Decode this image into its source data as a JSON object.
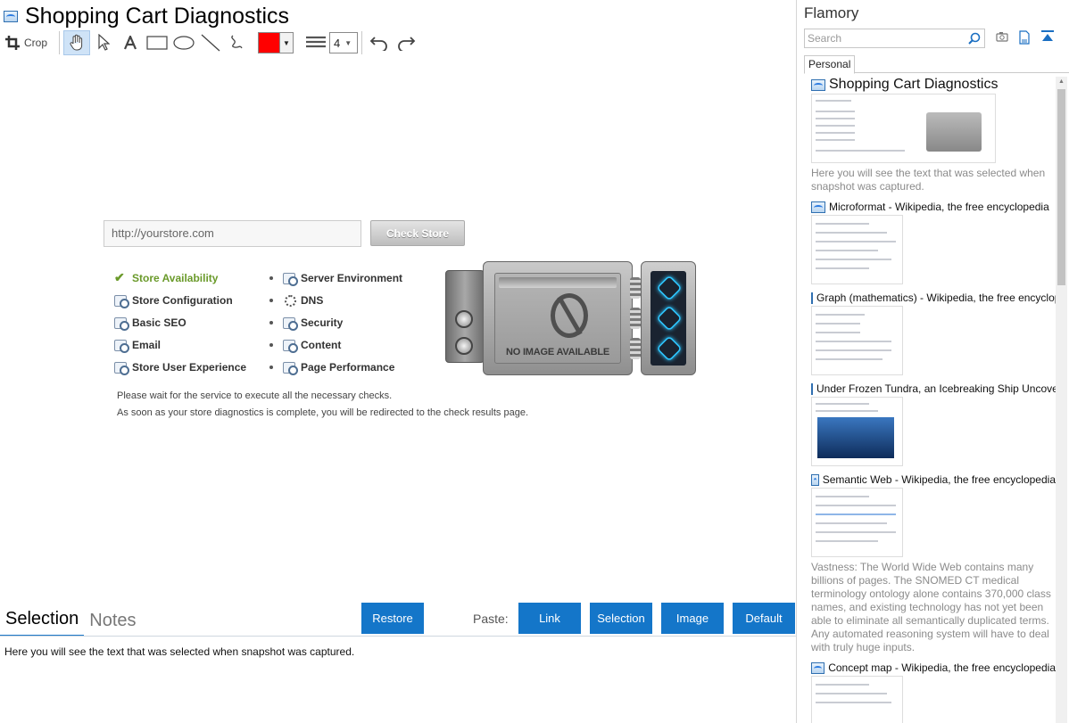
{
  "document": {
    "title": "Shopping Cart Diagnostics"
  },
  "toolbar": {
    "crop_label": "Crop",
    "stroke_width": "4",
    "pen_color": "#ff0000"
  },
  "snapshot": {
    "url_placeholder": "http://yourstore.com",
    "check_button": "Check Store",
    "checks_left": [
      {
        "label": "Store Availability",
        "state": "ok"
      },
      {
        "label": "Store Configuration",
        "state": "pending"
      },
      {
        "label": "Basic SEO",
        "state": "pending"
      },
      {
        "label": "Email",
        "state": "pending"
      },
      {
        "label": "Store User Experience",
        "state": "pending"
      }
    ],
    "checks_right": [
      {
        "label": "Server Environment",
        "state": "pending"
      },
      {
        "label": "DNS",
        "state": "running"
      },
      {
        "label": "Security",
        "state": "pending"
      },
      {
        "label": "Content",
        "state": "pending"
      },
      {
        "label": "Page Performance",
        "state": "pending"
      }
    ],
    "device_text": "NO IMAGE AVAILABLE",
    "message_line1": "Please wait for the service to execute all the necessary checks.",
    "message_line2": "As soon as your store diagnostics is complete, you will be redirected to the check results page."
  },
  "bottom": {
    "tab_selection": "Selection",
    "tab_notes": "Notes",
    "restore_button": "Restore",
    "paste_label": "Paste:",
    "paste_link": "Link",
    "paste_selection": "Selection",
    "paste_image": "Image",
    "paste_default": "Default",
    "selection_text": "Here you will see the text that was selected when snapshot was captured."
  },
  "sidebar": {
    "app_name": "Flamory",
    "search_placeholder": "Search",
    "tab_personal": "Personal",
    "entries": [
      {
        "title": "Shopping Cart Diagnostics",
        "snippet": "Here you will see the text that was selected when snapshot was captured."
      },
      {
        "title": "Microformat - Wikipedia, the free encyclopedia",
        "snippet": ""
      },
      {
        "title": "Graph (mathematics) - Wikipedia, the free encyclopedia",
        "snippet": ""
      },
      {
        "title": "Under Frozen Tundra, an Icebreaking Ship Uncovers",
        "snippet": ""
      },
      {
        "title": "Semantic Web - Wikipedia, the free encyclopedia",
        "snippet": "Vastness: The World Wide Web contains many billions of pages. The SNOMED CT medical terminology ontology alone contains 370,000 class names, and existing technology has not yet been able to eliminate all semantically duplicated terms. Any automated reasoning system will have to deal with truly huge inputs."
      },
      {
        "title": "Concept map - Wikipedia, the free encyclopedia",
        "snippet": ""
      }
    ]
  },
  "colors": {
    "accent": "#1476c9",
    "ok_green": "#6a9a2a"
  }
}
